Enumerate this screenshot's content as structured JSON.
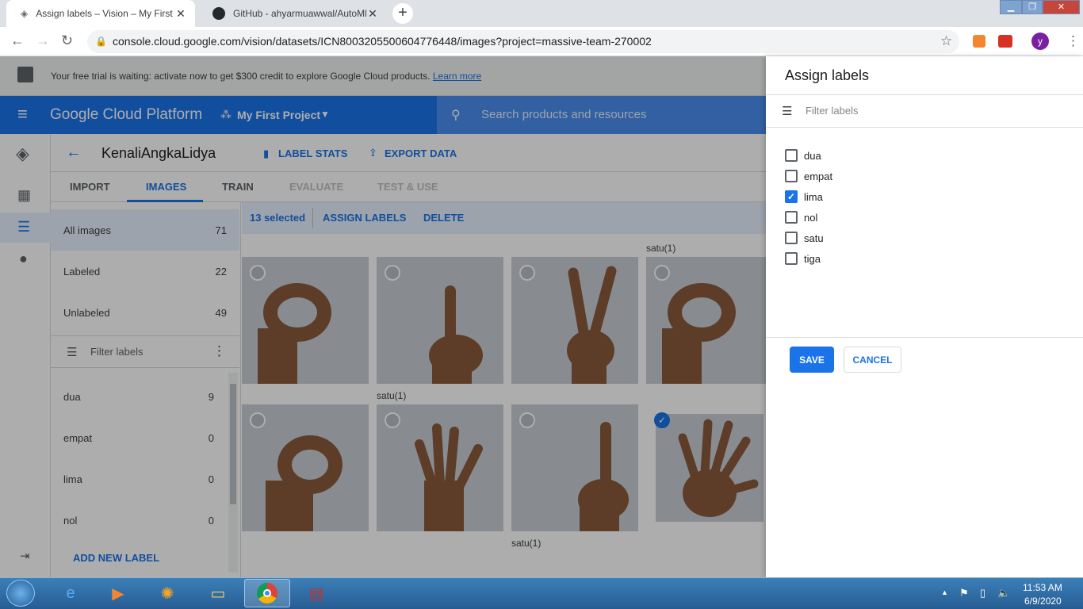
{
  "browser": {
    "tabs": [
      {
        "title": "Assign labels – Vision – My First P",
        "active": true
      },
      {
        "title": "GitHub - ahyarmuawwal/AutoML",
        "active": false
      }
    ],
    "new_tab": "+",
    "url": "console.cloud.google.com/vision/datasets/ICN8003205500604776448/images?project=massive-team-270002",
    "profile_initial": "y"
  },
  "trial_banner": {
    "text": "Your free trial is waiting: activate now to get $300 credit to explore Google Cloud products.",
    "link": "Learn more"
  },
  "header": {
    "brand": "Google Cloud Platform",
    "project": "My First Project",
    "search_placeholder": "Search products and resources"
  },
  "dataset": {
    "name": "KenaliAngkaLidya",
    "label_stats": "LABEL STATS",
    "export_data": "EXPORT DATA"
  },
  "nav_tabs": [
    "IMPORT",
    "IMAGES",
    "TRAIN",
    "EVALUATE",
    "TEST & USE"
  ],
  "sidebar": {
    "groups": [
      {
        "label": "All images",
        "count": "71"
      },
      {
        "label": "Labeled",
        "count": "22"
      },
      {
        "label": "Unlabeled",
        "count": "49"
      }
    ],
    "filter_placeholder": "Filter labels",
    "labels": [
      {
        "label": "dua",
        "count": "9"
      },
      {
        "label": "empat",
        "count": "0"
      },
      {
        "label": "lima",
        "count": "0"
      },
      {
        "label": "nol",
        "count": "0"
      }
    ],
    "add_new_label": "ADD NEW LABEL"
  },
  "selection": {
    "count_text": "13 selected",
    "assign": "ASSIGN LABELS",
    "delete": "DELETE"
  },
  "captions": {
    "top_right": "satu(1)",
    "row1_cell2": "satu(1)",
    "row2_cell3": "satu(1)"
  },
  "panel": {
    "title": "Assign labels",
    "filter_placeholder": "Filter labels",
    "labels": [
      {
        "label": "dua",
        "checked": false
      },
      {
        "label": "empat",
        "checked": false
      },
      {
        "label": "lima",
        "checked": true
      },
      {
        "label": "nol",
        "checked": false
      },
      {
        "label": "satu",
        "checked": false
      },
      {
        "label": "tiga",
        "checked": false
      }
    ],
    "save": "SAVE",
    "cancel": "CANCEL"
  },
  "taskbar": {
    "time": "11:53 AM",
    "date": "6/9/2020"
  },
  "colors": {
    "primary": "#1a73e8",
    "header": "#1a73e8",
    "scrim": "rgba(0,0,0,0.32)"
  }
}
